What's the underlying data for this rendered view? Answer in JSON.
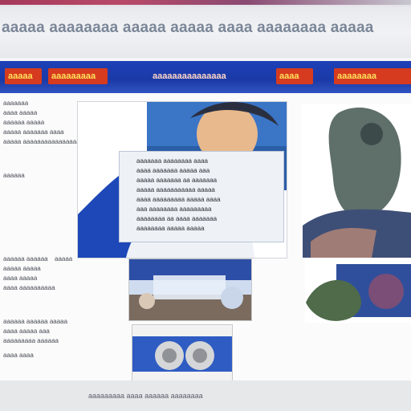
{
  "header": {
    "site_title": "aaaaa aaaaaaaa aaaaa aaaaa aaaa aaaaaaaa aaaaa"
  },
  "nav": {
    "items": [
      {
        "label": "aaaaa"
      },
      {
        "label": "aaaaaaaaa"
      },
      {
        "label": "aaaaaaaaaaaaaaa"
      },
      {
        "label": "aaaa"
      },
      {
        "label": "aaaaaaaa"
      }
    ]
  },
  "sidebar": {
    "lines": [
      "aaaaaaa",
      "aaaa aaaaa",
      "aaaaaa aaaaa",
      "aaaaa aaaaaaa aaaa",
      "aaaaa aaaaaaaaaaaaaaaaa",
      "aaaaaa",
      "aaaaaa aaaaaa",
      "aaaaa aaaaa",
      "aaaa aaaaa",
      "aaaa aaaaaaaaaa",
      "aaaaaa aaaaaa aaaaa",
      "aaaa aaaaa aaa",
      "aaaaaaaaa aaaaaa",
      "aaaa aaaa",
      "aaaaa"
    ]
  },
  "feature": {
    "caption_lines": [
      "aaaaaaa aaaaaaaa aaaa",
      "aaaa aaaaaaa aaaaa aaa",
      "aaaaa aaaaaaa aa aaaaaaa",
      "aaaaa aaaaaaaaaaa aaaaa",
      "aaaa aaaaaaaaa aaaaa aaaa",
      "aaa aaaaaaaa aaaaaaaaa",
      "aaaaaaaa aa aaaa aaaaaaa",
      "aaaaaaaa aaaaa aaaaa"
    ]
  },
  "footer": {
    "text": "aaaaaaaaa aaaa aaaaaa aaaaaaaa"
  },
  "colors": {
    "nav_bg": "#1b3aa6",
    "nav_red": "#d63b1f",
    "nav_gold": "#ffe25b"
  }
}
